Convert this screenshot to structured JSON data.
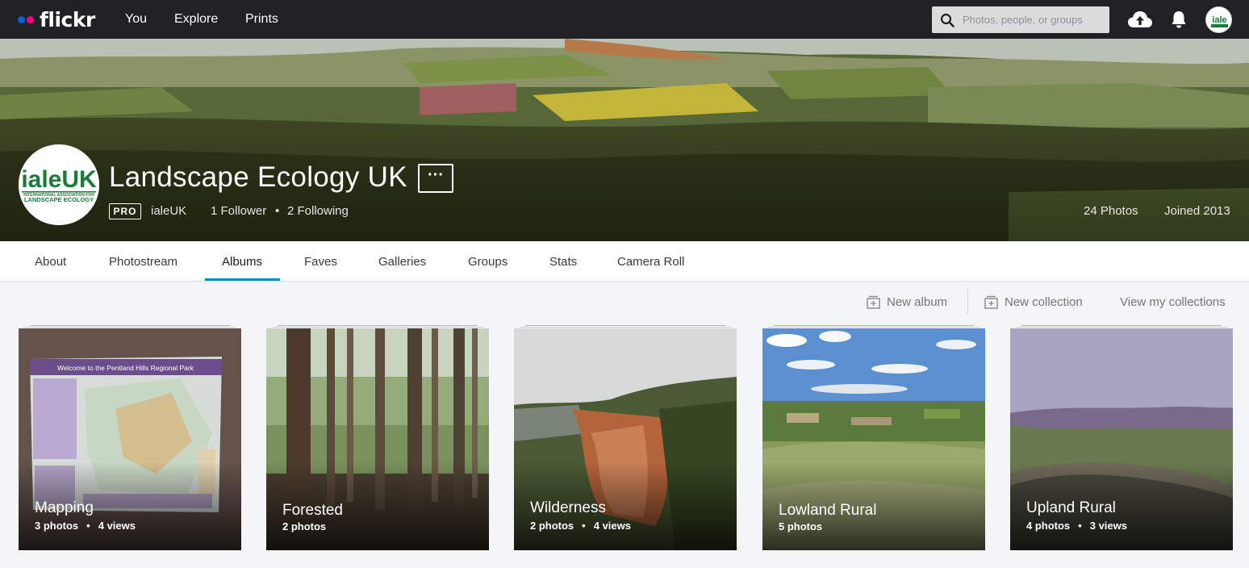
{
  "nav": {
    "logo": "flickr",
    "links": [
      "You",
      "Explore",
      "Prints"
    ],
    "search_placeholder": "Photos, people, or groups",
    "colors": {
      "bar": "#212124",
      "blue_dot": "#0063dc",
      "pink_dot": "#ff0084"
    }
  },
  "profile": {
    "name": "Landscape Ecology UK",
    "more": "···",
    "pro_badge": "PRO",
    "username": "ialeUK",
    "followers": "1 Follower",
    "following": "2 Following",
    "photos": "24 Photos",
    "joined": "Joined 2013",
    "avatar_logo": {
      "big": "ialeUK",
      "line1": "INTERNATIONAL ASSOCIATION FOR",
      "line2": "LANDSCAPE ECOLOGY"
    }
  },
  "tabs": [
    "About",
    "Photostream",
    "Albums",
    "Faves",
    "Galleries",
    "Groups",
    "Stats",
    "Camera Roll"
  ],
  "active_tab": "Albums",
  "actions": {
    "new_album": "New album",
    "new_collection": "New collection",
    "view_collections": "View my collections"
  },
  "albums": [
    {
      "title": "Mapping",
      "photos": "3 photos",
      "views": "4 views"
    },
    {
      "title": "Forested",
      "photos": "2 photos",
      "views": ""
    },
    {
      "title": "Wilderness",
      "photos": "2 photos",
      "views": "4 views"
    },
    {
      "title": "Lowland Rural",
      "photos": "5 photos",
      "views": ""
    },
    {
      "title": "Upland Rural",
      "photos": "4 photos",
      "views": "3 views"
    }
  ],
  "sign_text": "Welcome to the Pentland Hills Regional Park"
}
